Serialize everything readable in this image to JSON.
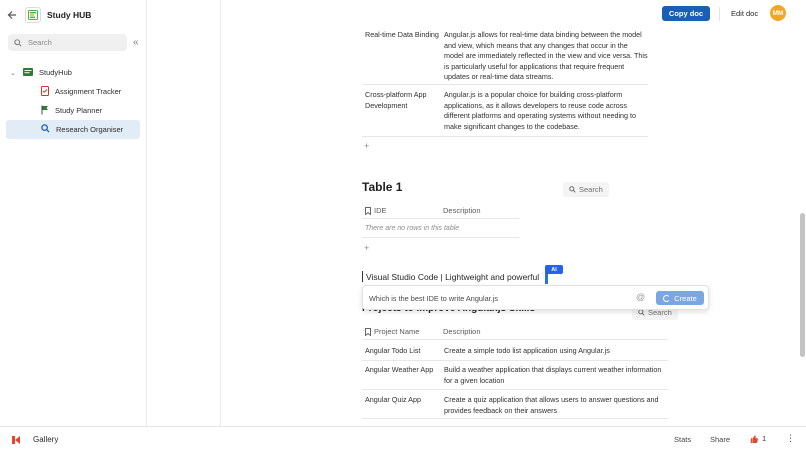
{
  "app": {
    "title": "Study HUB"
  },
  "sidebar": {
    "search_placeholder": "Search",
    "root": {
      "label": "StudyHub",
      "icon": "folder-icon"
    },
    "items": [
      {
        "label": "Assignment Tracker",
        "icon": "checklist-icon",
        "active": false
      },
      {
        "label": "Study Planner",
        "icon": "flag-icon",
        "active": false
      },
      {
        "label": "Research Organiser",
        "icon": "magnifier-icon",
        "active": true
      }
    ]
  },
  "topbar": {
    "copy_label": "Copy doc",
    "edit_label": "Edit doc",
    "avatar_initials": "MM"
  },
  "top_table": {
    "rows": [
      {
        "feature": "Real-time Data Binding",
        "description": "Angular.js allows for real-time data binding between the model and view, which means that any changes that occur in the model are immediately reflected in the view and vice versa. This is particularly useful for applications that require frequent updates or real-time data streams."
      },
      {
        "feature": "Cross-platform App Development",
        "description": "Angular.js is a popular choice for building cross-platform applications, as it allows developers to reuse code across different platforms and operating systems without needing to make significant changes to the codebase."
      }
    ],
    "add_label": "+"
  },
  "table1": {
    "title": "Table 1",
    "search_label": "Search",
    "columns": [
      "IDE",
      "Description"
    ],
    "empty_text": "There are no rows in this table",
    "add_label": "+"
  },
  "ai": {
    "typed_text": "Visual Studio Code | Lightweight and powerful",
    "badge": "AI",
    "prompt": "Which is the best IDE to write Angular.js",
    "at_symbol": "@",
    "create_label": "Create"
  },
  "projects": {
    "title": "Projects to Improve Angular.js Skills",
    "search_label": "Search",
    "columns": [
      "Project Name",
      "Description"
    ],
    "rows": [
      {
        "name": "Angular Todo List",
        "description": "Create a simple todo list application using Angular.js"
      },
      {
        "name": "Angular Weather App",
        "description": "Build a weather application that displays current weather information for a given location"
      },
      {
        "name": "Angular Quiz App",
        "description": "Create a quiz application that allows users to answer questions and provides feedback on their answers"
      }
    ]
  },
  "bottombar": {
    "gallery_label": "Gallery",
    "stats_label": "Stats",
    "share_label": "Share",
    "like_count": "1"
  },
  "colors": {
    "accent": "#1a5fb4",
    "avatar": "#f5a623",
    "active_item": "#e1ecf7",
    "ai_badge": "#2563eb"
  }
}
